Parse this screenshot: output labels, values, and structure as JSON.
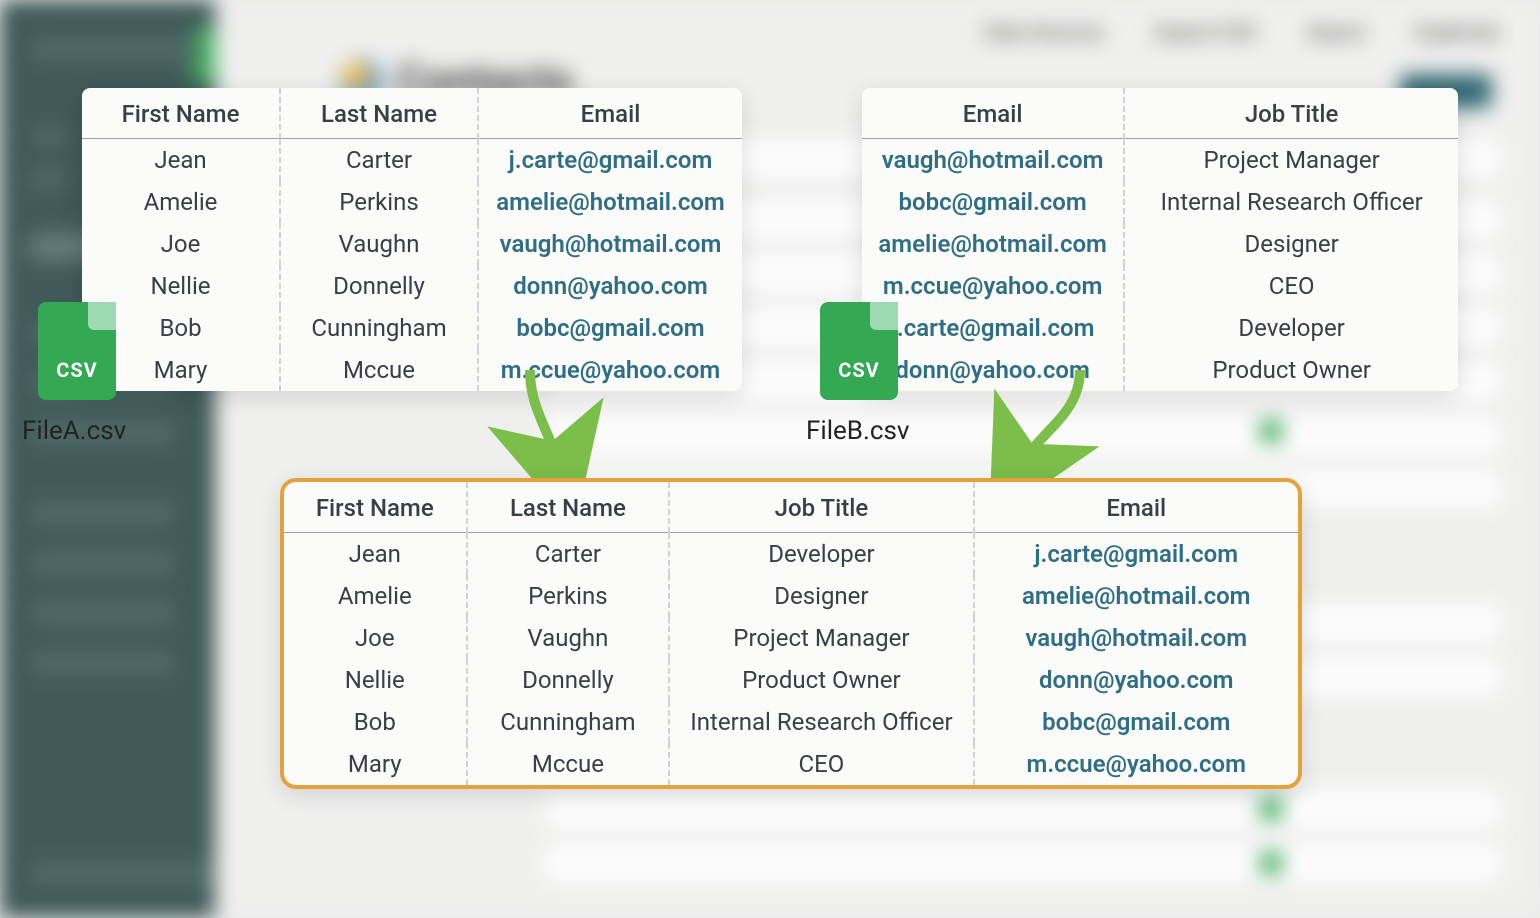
{
  "background": {
    "page_title": "Contacts",
    "top_tabs": [
      "Data Sources",
      "Import CSV",
      "Export",
      "Duplicate"
    ]
  },
  "fileA": {
    "filename": "FileA.csv",
    "headers": [
      "First Name",
      "Last Name",
      "Email"
    ],
    "rows": [
      {
        "first": "Jean",
        "last": "Carter",
        "email": "j.carte@gmail.com"
      },
      {
        "first": "Amelie",
        "last": "Perkins",
        "email": "amelie@hotmail.com"
      },
      {
        "first": "Joe",
        "last": "Vaughn",
        "email": "vaugh@hotmail.com"
      },
      {
        "first": "Nellie",
        "last": "Donnelly",
        "email": "donn@yahoo.com"
      },
      {
        "first": "Bob",
        "last": "Cunningham",
        "email": "bobc@gmail.com"
      },
      {
        "first": "Mary",
        "last": "Mccue",
        "email": "m.ccue@yahoo.com"
      }
    ]
  },
  "fileB": {
    "filename": "FileB.csv",
    "headers": [
      "Email",
      "Job Title"
    ],
    "rows": [
      {
        "email": "vaugh@hotmail.com",
        "title": "Project Manager"
      },
      {
        "email": "bobc@gmail.com",
        "title": "Internal Research Officer"
      },
      {
        "email": "amelie@hotmail.com",
        "title": "Designer"
      },
      {
        "email": "m.ccue@yahoo.com",
        "title": "CEO"
      },
      {
        "email": "j.carte@gmail.com",
        "title": "Developer"
      },
      {
        "email": "donn@yahoo.com",
        "title": "Product Owner"
      }
    ]
  },
  "merged": {
    "headers": [
      "First Name",
      "Last Name",
      "Job Title",
      "Email"
    ],
    "rows": [
      {
        "first": "Jean",
        "last": "Carter",
        "title": "Developer",
        "email": "j.carte@gmail.com"
      },
      {
        "first": "Amelie",
        "last": "Perkins",
        "title": "Designer",
        "email": "amelie@hotmail.com"
      },
      {
        "first": "Joe",
        "last": "Vaughn",
        "title": "Project Manager",
        "email": "vaugh@hotmail.com"
      },
      {
        "first": "Nellie",
        "last": "Donnelly",
        "title": "Product Owner",
        "email": "donn@yahoo.com"
      },
      {
        "first": "Bob",
        "last": "Cunningham",
        "title": "Internal Research Officer",
        "email": "bobc@gmail.com"
      },
      {
        "first": "Mary",
        "last": "Mccue",
        "title": "CEO",
        "email": "m.ccue@yahoo.com"
      }
    ]
  }
}
